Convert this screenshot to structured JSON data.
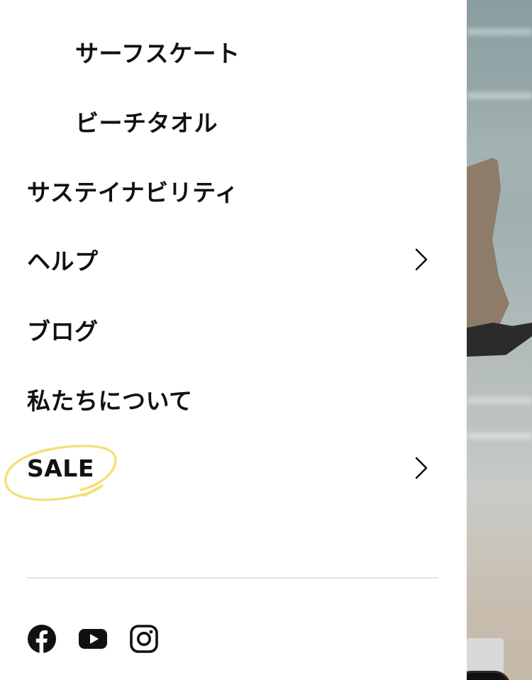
{
  "menu": {
    "items": [
      {
        "label": "サーフスケート",
        "level": "sub",
        "has_submenu": false
      },
      {
        "label": "ビーチタオル",
        "level": "sub",
        "has_submenu": false
      },
      {
        "label": "サステイナビリティ",
        "level": "top",
        "has_submenu": false
      },
      {
        "label": "ヘルプ",
        "level": "top",
        "has_submenu": true
      },
      {
        "label": "ブログ",
        "level": "top",
        "has_submenu": false
      },
      {
        "label": "私たちについて",
        "level": "top",
        "has_submenu": false
      },
      {
        "label": "SALE",
        "level": "top",
        "has_submenu": true,
        "highlighted": true
      }
    ]
  },
  "social": {
    "icons": [
      "facebook-icon",
      "youtube-icon",
      "instagram-icon"
    ]
  },
  "colors": {
    "text": "#111111",
    "divider": "#e3e3e3",
    "highlight_circle": "#f5e07a"
  }
}
